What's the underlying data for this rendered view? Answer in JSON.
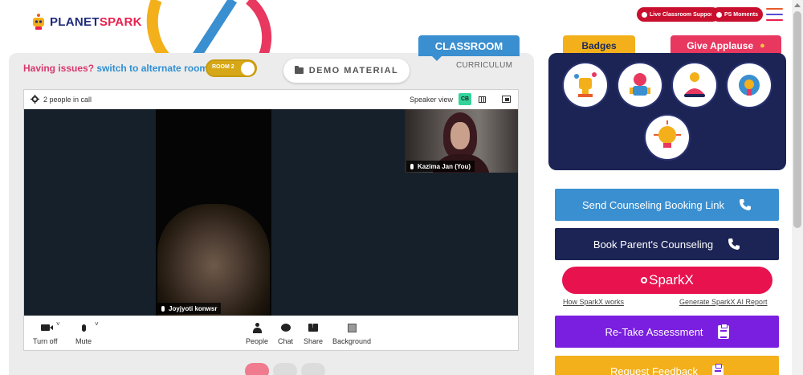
{
  "header": {
    "logo_part1": "PLANET",
    "logo_part2": "SPARK",
    "live_support_label": "Live Classroom Support",
    "ps_moments_label": "PS Moments"
  },
  "left": {
    "tabs": {
      "classroom": "CLASSROOM",
      "curriculum": "CURRICULUM"
    },
    "issues_text": "Having issues?",
    "switch_text": "switch to alternate room",
    "room_toggle_label": "ROOM 2",
    "demo_material_label": "DEMO MATERIAL"
  },
  "call": {
    "people_count": "2 people in call",
    "speaker_view_label": "Speaker view",
    "view_cb_label": "CB",
    "main_participant": "Joyjyoti konwsr",
    "self_participant": "Kazima Jan (You)",
    "controls": [
      {
        "key": "camera",
        "label": "Turn off"
      },
      {
        "key": "mic",
        "label": "Mute"
      },
      {
        "key": "people",
        "label": "People"
      },
      {
        "key": "chat",
        "label": "Chat"
      },
      {
        "key": "share",
        "label": "Share"
      },
      {
        "key": "background",
        "label": "Background"
      }
    ]
  },
  "right": {
    "badges_tab": "Badges",
    "applause_tab": "Give Applause",
    "badges": [
      "trophy-badge",
      "superhero-badge",
      "meditation-badge",
      "idea-badge",
      "lightbulb-badge"
    ],
    "buttons": {
      "send_counseling": "Send Counseling Booking Link",
      "book_parent": "Book Parent's Counseling",
      "sparkx": "SparkX",
      "retake": "Re-Take Assessment",
      "request_feedback": "Request Feedback"
    },
    "links": {
      "how_sparkx": "How SparkX works",
      "generate_report": "Generate SparkX AI Report"
    }
  },
  "colors": {
    "classroom_tab": "#3a8fd0",
    "badges_tab": "#f3b01b",
    "applause_tab": "#e8385f",
    "badge_panel": "#1c2456",
    "send_counseling": "#3a8fd0",
    "book_parent": "#1c2456",
    "sparkx": "#e8124e",
    "retake": "#7a1ee0",
    "request_feedback": "#f3b01b"
  }
}
